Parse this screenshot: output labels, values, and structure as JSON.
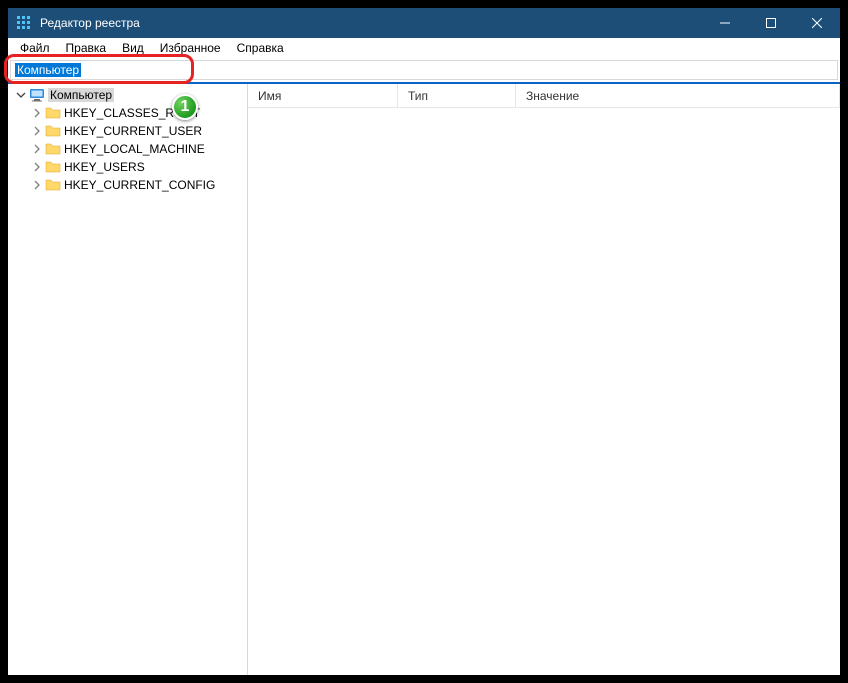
{
  "window": {
    "title": "Редактор реестра"
  },
  "menu": {
    "file": "Файл",
    "edit": "Правка",
    "view": "Вид",
    "favorites": "Избранное",
    "help": "Справка"
  },
  "address": {
    "value": "Компьютер"
  },
  "tree": {
    "root": "Компьютер",
    "keys": [
      "HKEY_CLASSES_ROOT",
      "HKEY_CURRENT_USER",
      "HKEY_LOCAL_MACHINE",
      "HKEY_USERS",
      "HKEY_CURRENT_CONFIG"
    ]
  },
  "columns": {
    "name": "Имя",
    "type": "Тип",
    "value": "Значение"
  },
  "callout": {
    "number": "1"
  }
}
